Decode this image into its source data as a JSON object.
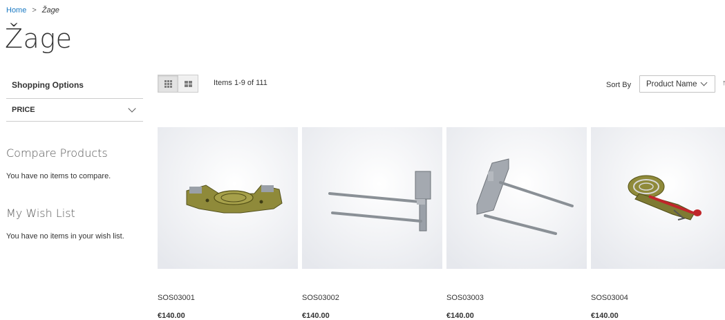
{
  "breadcrumb": {
    "home": "Home",
    "separator": ">",
    "current": "Žage"
  },
  "page": {
    "title": "Žage"
  },
  "sidebar": {
    "filter_title": "Shopping Options",
    "filters": [
      {
        "label": "PRICE"
      }
    ],
    "compare": {
      "title": "Compare Products",
      "empty": "You have no items to compare."
    },
    "wishlist": {
      "title": "My Wish List",
      "empty": "You have no items in your wish list."
    }
  },
  "toolbar": {
    "view_modes": [
      "grid-icon",
      "list-icon"
    ],
    "amount": "Items 1-9 of 111",
    "sort_label": "Sort By",
    "sort_value": "Product Name",
    "sort_direction_icon": "↑"
  },
  "products": [
    {
      "name": "SOS03001",
      "price": "€140.00",
      "icon": "saw-part-icon"
    },
    {
      "name": "SOS03002",
      "price": "€140.00",
      "icon": "rail-assembly-icon"
    },
    {
      "name": "SOS03003",
      "price": "€140.00",
      "icon": "rail-assembly-angled-icon"
    },
    {
      "name": "SOS03004",
      "price": "€140.00",
      "icon": "adjuster-part-icon"
    }
  ],
  "colors": {
    "link": "#1979c3",
    "part_olive": "#8f8a3a",
    "part_metal": "#9a9fa6",
    "part_red": "#c0262a"
  }
}
